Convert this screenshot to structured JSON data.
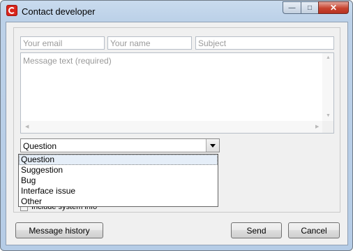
{
  "window": {
    "title": "Contact developer"
  },
  "form": {
    "email_placeholder": "Your email",
    "name_placeholder": "Your name",
    "subject_placeholder": "Subject",
    "message_placeholder": "Message text (required)"
  },
  "category": {
    "selected": "Question",
    "options": [
      "Question",
      "Suggestion",
      "Bug",
      "Interface issue",
      "Other"
    ]
  },
  "include_system_info_label": "Include system info",
  "buttons": {
    "history": "Message history",
    "send": "Send",
    "cancel": "Cancel"
  }
}
